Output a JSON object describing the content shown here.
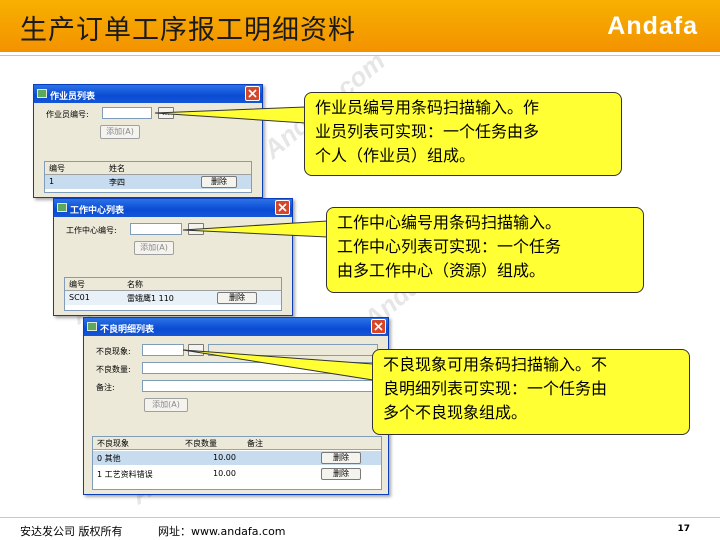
{
  "slide": {
    "title": "生产订单工序报工明细资料",
    "brand": "Andafa",
    "watermark": "Andafa.com",
    "page_number": "17",
    "footer": {
      "copyright": "安达发公司 版权所有",
      "url": "网址：www.andafa.com"
    }
  },
  "windows": {
    "operator": {
      "title": "作业员列表",
      "field_label": "作业员编号:",
      "field_value": "",
      "lookup_label": "…",
      "add_button": "添加(A)",
      "columns": [
        "编号",
        "姓名"
      ],
      "rows": [
        {
          "code": "1",
          "name": "李四",
          "action": "删除"
        }
      ]
    },
    "workcenter": {
      "title": "工作中心列表",
      "field_label": "工作中心编号:",
      "field_value": "",
      "lookup_label": "…",
      "add_button": "添加(A)",
      "columns": [
        "编号",
        "名称"
      ],
      "rows": [
        {
          "code": "SC01",
          "name": "雷蛾鹰1 110",
          "action": "删除"
        }
      ]
    },
    "defect": {
      "title": "不良明细列表",
      "phenomenon_label": "不良现象:",
      "quantity_label": "不良数量:",
      "remark_label": "备注:",
      "lookup_label": "…",
      "add_button": "添加(A)",
      "columns": [
        "不良现象",
        "不良数量",
        "备注"
      ],
      "rows": [
        {
          "phenomenon": "0 其他",
          "quantity": "10.00",
          "remark": "",
          "action": "删除"
        },
        {
          "phenomenon": "1 工艺资料错误",
          "quantity": "10.00",
          "remark": "",
          "action": "删除"
        }
      ]
    }
  },
  "callouts": {
    "operator": {
      "line1": "作业员编号用条码扫描输入。作",
      "line2": "业员列表可实现：一个任务由多",
      "line3": "个人（作业员）组成。"
    },
    "workcenter": {
      "line1": "工作中心编号用条码扫描输入。",
      "line2": "工作中心列表可实现：一个任务",
      "line3": "由多工作中心（资源）组成。"
    },
    "defect": {
      "line1": "不良现象可用条码扫描输入。不",
      "line2": "良明细列表可实现：一个任务由",
      "line3": "多个不良现象组成。"
    }
  },
  "colors": {
    "header": "#f39200",
    "callout": "#ffff33",
    "titlebar": "#0a4bd4",
    "close": "#d6472a"
  }
}
